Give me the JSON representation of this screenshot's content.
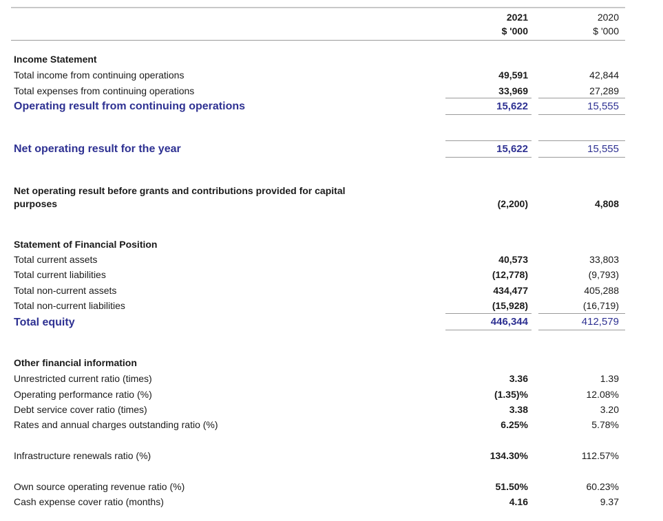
{
  "columns": {
    "year_2021": "2021",
    "unit_2021": "$ '000",
    "year_2020": "2020",
    "unit_2020": "$ '000"
  },
  "income_statement": {
    "heading": "Income Statement",
    "rows": [
      {
        "label": "Total income from continuing operations",
        "v2021": "49,591",
        "v2020": "42,844"
      },
      {
        "label": "Total expenses from continuing operations",
        "v2021": "33,969",
        "v2020": "27,289"
      },
      {
        "label": "Operating result from continuing operations",
        "v2021": "15,622",
        "v2020": "15,555"
      }
    ]
  },
  "net_operating": {
    "label": "Net operating result for the year",
    "v2021": "15,622",
    "v2020": "15,555"
  },
  "net_before_grants": {
    "label_line1": "Net operating result before grants and contributions provided for capital",
    "label_line2": "purposes",
    "v2021": "(2,200)",
    "v2020": "4,808"
  },
  "financial_position": {
    "heading": "Statement of Financial Position",
    "rows": [
      {
        "label": "Total current assets",
        "v2021": "40,573",
        "v2020": "33,803"
      },
      {
        "label": "Total current liabilities",
        "v2021": "(12,778)",
        "v2020": "(9,793)"
      },
      {
        "label": "Total non-current assets",
        "v2021": "434,477",
        "v2020": "405,288"
      },
      {
        "label": "Total non-current liabilities",
        "v2021": "(15,928)",
        "v2020": "(16,719)"
      },
      {
        "label": "Total equity",
        "v2021": "446,344",
        "v2020": "412,579"
      }
    ]
  },
  "other_info": {
    "heading": "Other financial information",
    "rows": [
      {
        "label": "Unrestricted current ratio (times)",
        "v2021": "3.36",
        "v2020": "1.39"
      },
      {
        "label": "Operating performance ratio (%)",
        "v2021": "(1.35)%",
        "v2020": "12.08%"
      },
      {
        "label": "Debt service cover ratio (times)",
        "v2021": "3.38",
        "v2020": "3.20"
      },
      {
        "label": "Rates and annual charges outstanding ratio (%)",
        "v2021": "6.25%",
        "v2020": "5.78%"
      },
      {
        "label": "Infrastructure renewals ratio (%)",
        "v2021": "134.30%",
        "v2020": "112.57%"
      },
      {
        "label": "Own source operating revenue ratio (%)",
        "v2021": "51.50%",
        "v2020": "60.23%"
      },
      {
        "label": "Cash expense cover ratio (months)",
        "v2021": "4.16",
        "v2020": "9.37"
      }
    ]
  },
  "colors": {
    "accent_blue": "#2e3192",
    "rule_gray": "#9a9a9a"
  }
}
